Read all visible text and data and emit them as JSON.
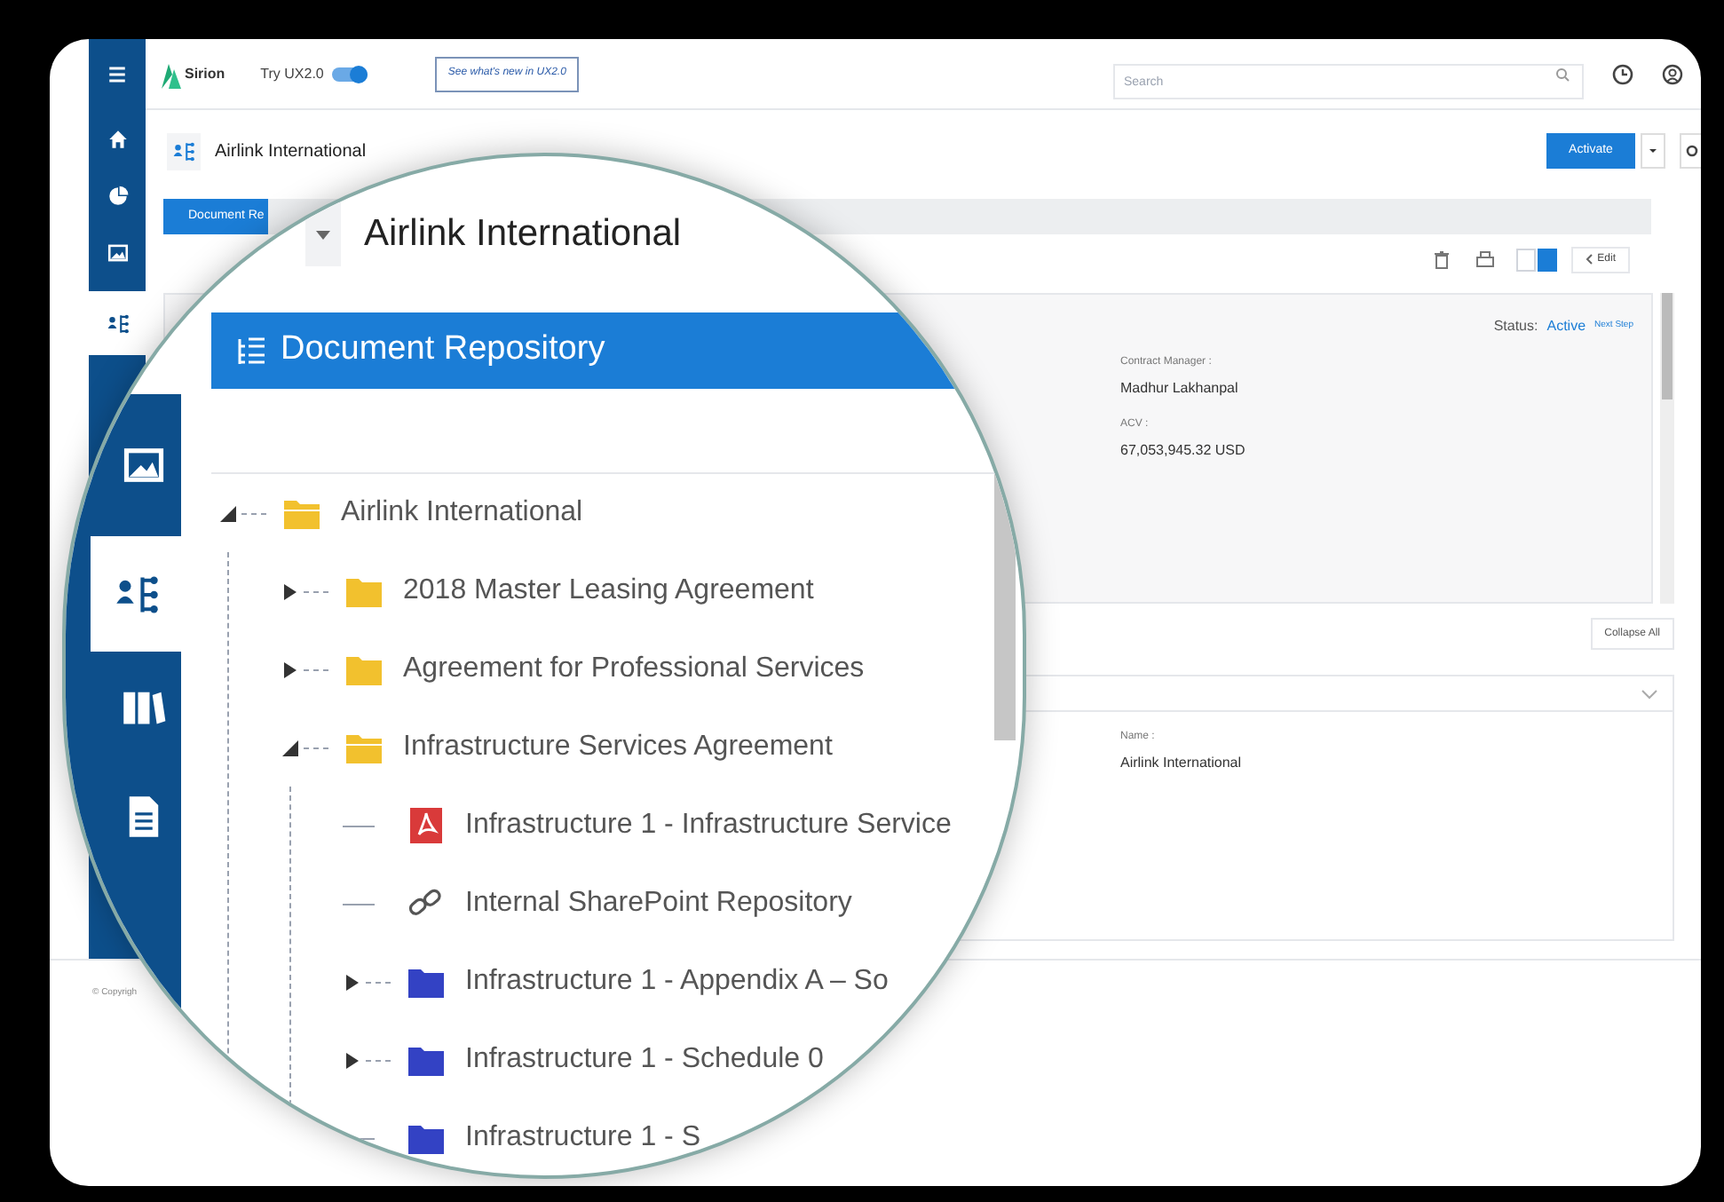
{
  "top_bar": {
    "logo": "Sirion",
    "toggle": {
      "label": "Try UX2.0",
      "on": true
    },
    "whats_new": "See what's new in UX2.0",
    "search": {
      "placeholder": "Search"
    }
  },
  "sidebar": {
    "items": [
      {
        "kind": "home",
        "selected": false
      },
      {
        "kind": "pie",
        "selected": false
      },
      {
        "kind": "image",
        "selected": false
      },
      {
        "kind": "hierarchy",
        "selected": true
      }
    ]
  },
  "header": {
    "title": "Airlink International",
    "activate": "Activate"
  },
  "tab": {
    "label": "Document Re"
  },
  "toolbar": {
    "views": [
      {
        "selected": false
      },
      {
        "selected": true
      }
    ],
    "edit": "Edit"
  },
  "summary": {
    "status_label": "Status:",
    "status": "Active",
    "next_step": "Next Step",
    "fields": [
      {
        "label": "Contract Manager :",
        "value": "Madhur Lakhanpal"
      },
      {
        "label": "ACV :",
        "value": "67,053,945.32 USD"
      }
    ]
  },
  "collapse_all": "Collapse All",
  "details": {
    "fields": [
      {
        "label": "Name :",
        "value": "Airlink International"
      }
    ]
  },
  "footer": "© Copyrigh",
  "magnifier": {
    "title": "Airlink International",
    "panel_title": "Document Repository",
    "sidebar": [
      {
        "kind": "image",
        "selected": false
      },
      {
        "kind": "hierarchy",
        "selected": true
      },
      {
        "kind": "books",
        "selected": false
      },
      {
        "kind": "document",
        "selected": false
      }
    ],
    "tree": [
      {
        "label": "Airlink International",
        "kind": "folder",
        "color": "#f2c12e",
        "expanded": true,
        "children": [
          {
            "label": "2018 Master Leasing Agreement",
            "kind": "folder",
            "color": "#f2c12e",
            "expanded": false
          },
          {
            "label": "Agreement for Professional Services",
            "kind": "folder",
            "color": "#f2c12e",
            "expanded": false
          },
          {
            "label": "Infrastructure Services Agreement",
            "kind": "folder",
            "color": "#f2c12e",
            "expanded": true,
            "children": [
              {
                "label": "Infrastructure 1 - Infrastructure Service",
                "kind": "pdf"
              },
              {
                "label": "Internal SharePoint Repository",
                "kind": "link"
              },
              {
                "label": "Infrastructure 1 - Appendix A – So",
                "kind": "folder",
                "color": "#3342c4",
                "expanded": false
              },
              {
                "label": "Infrastructure 1 - Schedule 0",
                "kind": "folder",
                "color": "#3342c4",
                "expanded": false
              },
              {
                "label": "Infrastructure 1 - S",
                "kind": "folder",
                "color": "#3342c4"
              }
            ]
          }
        ]
      }
    ]
  }
}
